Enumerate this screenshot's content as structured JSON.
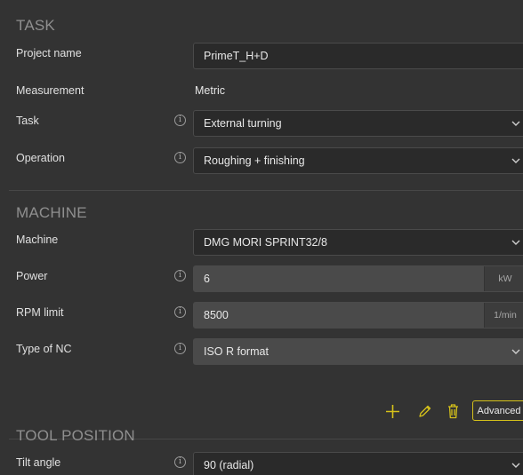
{
  "task": {
    "section_title": "TASK",
    "project_name_label": "Project name",
    "project_name_value": "PrimeT_H+D",
    "measurement_label": "Measurement",
    "measurement_value": "Metric",
    "task_label": "Task",
    "task_value": "External turning",
    "operation_label": "Operation",
    "operation_value": "Roughing + finishing"
  },
  "machine": {
    "section_title": "MACHINE",
    "machine_label": "Machine",
    "machine_value": "DMG MORI SPRINT32/8",
    "power_label": "Power",
    "power_value": "6",
    "power_unit": "kW",
    "rpm_label": "RPM limit",
    "rpm_value": "8500",
    "rpm_unit": "1/min",
    "nc_label": "Type of NC",
    "nc_value": "ISO R format",
    "advanced_label": "Advanced"
  },
  "tool_position": {
    "section_title": "TOOL POSITION",
    "tilt_label": "Tilt angle",
    "tilt_value": "90 (radial)"
  },
  "icons": {
    "info_glyph": "i",
    "info": "info-icon",
    "dropdown": "chevron-down-icon",
    "add": "plus-icon",
    "edit": "pencil-icon",
    "delete": "trash-icon"
  },
  "colors": {
    "background": "#333333",
    "accent": "#d6c21a",
    "filled_field": "#4a4a4a",
    "section_title": "#8f8f8f"
  }
}
